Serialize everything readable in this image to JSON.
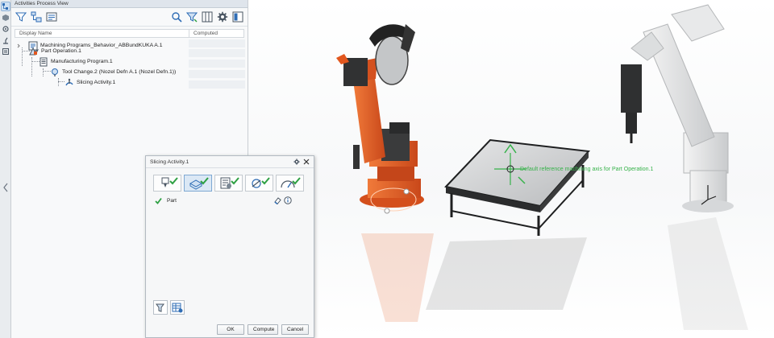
{
  "panel": {
    "title": "Activities Process View",
    "columns": {
      "display_name": "Display Name",
      "computed": "Computed"
    },
    "tree": [
      {
        "label": "Machining Programs_Behavior_ABBundKUKA A.1",
        "icon": "machining-programs-icon"
      },
      {
        "label": "Part Operation.1",
        "icon": "part-operation-icon"
      },
      {
        "label": "Manufacturing Program.1",
        "icon": "manufacturing-program-icon"
      },
      {
        "label": "Tool Change.2 (Nozel Defn A.1 (Nozel Defn.1))",
        "icon": "tool-change-icon"
      },
      {
        "label": "Slicing Activity.1",
        "icon": "slicing-activity-icon"
      }
    ]
  },
  "dialog": {
    "title": "Slicing Activity.1",
    "tabs": [
      "nozzle-tab",
      "part-tab",
      "parameters-tab",
      "strategy-tab",
      "feeds-speeds-tab"
    ],
    "part_label": "Part",
    "buttons": {
      "ok": "OK",
      "compute": "Compute",
      "cancel": "Cancel"
    }
  },
  "scene": {
    "ref_label": "Default reference machining axis for Part Operation.1"
  },
  "colors": {
    "accent_blue": "#2f6db5",
    "check_green": "#2ea043",
    "kuka_orange": "#e2571e",
    "axis_green": "#36b24a"
  }
}
